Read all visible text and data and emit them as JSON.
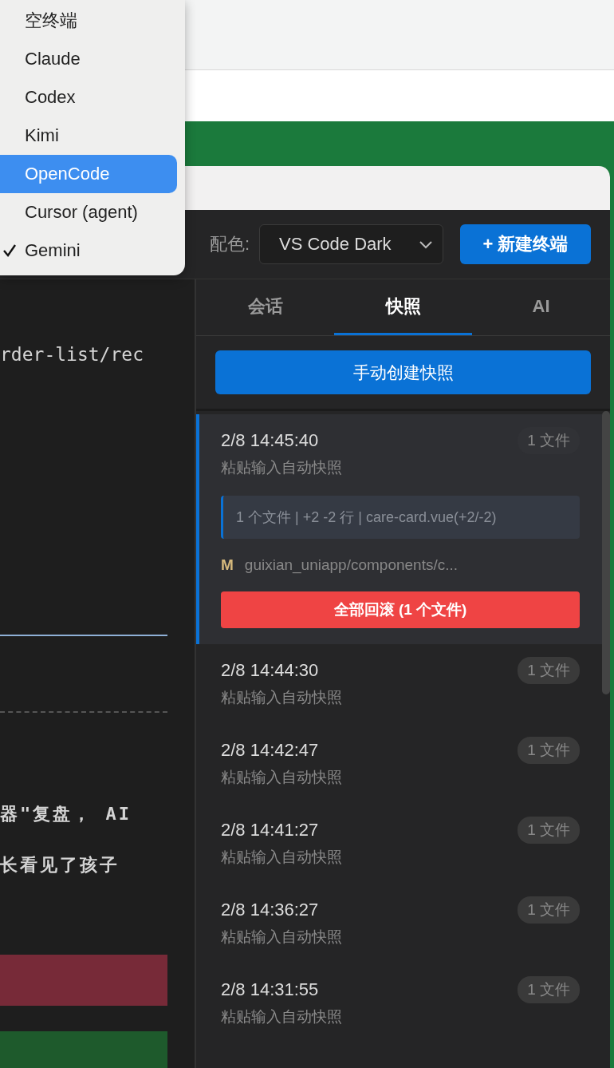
{
  "agent_menu": {
    "items": [
      {
        "label": "空终端",
        "selected": false,
        "checked": false
      },
      {
        "label": "Claude",
        "selected": false,
        "checked": false
      },
      {
        "label": "Codex",
        "selected": false,
        "checked": false
      },
      {
        "label": "Kimi",
        "selected": false,
        "checked": false
      },
      {
        "label": "OpenCode",
        "selected": true,
        "checked": false
      },
      {
        "label": "Cursor (agent)",
        "selected": false,
        "checked": false
      },
      {
        "label": "Gemini",
        "selected": false,
        "checked": true
      }
    ]
  },
  "toolbar": {
    "theme_label": "配色:",
    "theme_select": "VS Code Dark",
    "new_terminal_button": "+ 新建终端"
  },
  "terminal": {
    "lines": [
      {
        "kind": "blank"
      },
      {
        "kind": "blank"
      },
      {
        "kind": "text",
        "text": "rder-list/rec"
      },
      {
        "kind": "blank"
      },
      {
        "kind": "blank"
      },
      {
        "kind": "blank"
      },
      {
        "kind": "blank"
      },
      {
        "kind": "blank"
      },
      {
        "kind": "blank"
      },
      {
        "kind": "blank"
      },
      {
        "kind": "blank"
      },
      {
        "kind": "blank"
      },
      {
        "kind": "blank"
      },
      {
        "kind": "solid-rule"
      },
      {
        "kind": "blank"
      },
      {
        "kind": "blank"
      },
      {
        "kind": "dashed-rule"
      },
      {
        "kind": "blank"
      },
      {
        "kind": "blank"
      },
      {
        "kind": "blank"
      },
      {
        "kind": "bold-text",
        "text": "器\"复盘， AI"
      },
      {
        "kind": "blank"
      },
      {
        "kind": "bold-text",
        "text": "长看见了孩子"
      },
      {
        "kind": "blank"
      },
      {
        "kind": "blank"
      },
      {
        "kind": "blank"
      },
      {
        "kind": "deleted"
      },
      {
        "kind": "blank"
      },
      {
        "kind": "added"
      }
    ]
  },
  "side_panel": {
    "tabs": [
      {
        "label": "会话",
        "selected": false
      },
      {
        "label": "快照",
        "selected": true
      },
      {
        "label": "AI",
        "selected": false
      }
    ],
    "create_snapshot_button": "手动创建快照",
    "snapshots": [
      {
        "time": "2/8 14:45:40",
        "description": "粘贴输入自动快照",
        "count": "1 文件",
        "selected": true,
        "summary": "1 个文件 | +2 -2 行 | care-card.vue(+2/-2)",
        "files": [
          {
            "status": "M",
            "path": "guixian_uniapp/components/c..."
          }
        ],
        "rollback_button": "全部回滚 (1 个文件)"
      },
      {
        "time": "2/8 14:44:30",
        "description": "粘贴输入自动快照",
        "count": "1 文件",
        "selected": false
      },
      {
        "time": "2/8 14:42:47",
        "description": "粘贴输入自动快照",
        "count": "1 文件",
        "selected": false
      },
      {
        "time": "2/8 14:41:27",
        "description": "粘贴输入自动快照",
        "count": "1 文件",
        "selected": false
      },
      {
        "time": "2/8 14:36:27",
        "description": "粘贴输入自动快照",
        "count": "1 文件",
        "selected": false
      },
      {
        "time": "2/8 14:31:55",
        "description": "粘贴输入自动快照",
        "count": "1 文件",
        "selected": false
      }
    ]
  }
}
